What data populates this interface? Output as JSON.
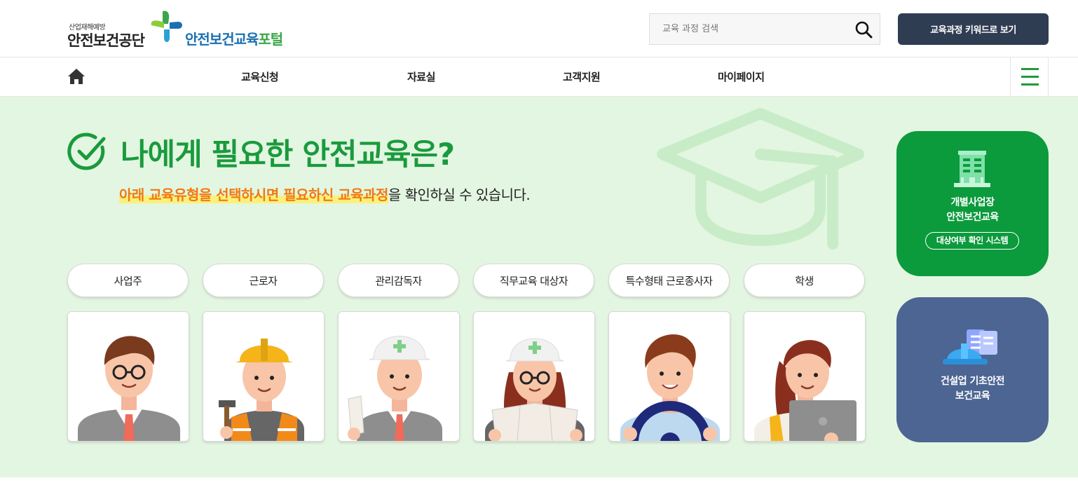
{
  "header": {
    "logo_small": "산업재해예방",
    "logo_main": "안전보건공단",
    "portal_part1": "안전보건교육",
    "portal_part2": "포털",
    "search_placeholder": "교육 과정 검색",
    "keyword_button": "교육과정 키워드로 보기"
  },
  "nav": {
    "items": [
      "교육신청",
      "자료실",
      "고객지원",
      "마이페이지"
    ]
  },
  "hero": {
    "title": "나에게 필요한 안전교육은?",
    "subtitle_highlight": "아래 교육유형을 선택하시면 필요하신 교육과정",
    "subtitle_rest": "을 확인하실 수 있습니다.",
    "categories": [
      "사업주",
      "근로자",
      "관리감독자",
      "직무교육 대상자",
      "특수형태 근로종사자",
      "학생"
    ]
  },
  "side": {
    "card1_line1": "개별사업장",
    "card1_line2": "안전보건교육",
    "card1_tag": "대상여부 확인 시스템",
    "card2_line1": "건설업 기초안전",
    "card2_line2": "보건교육"
  },
  "colors": {
    "brand_green": "#1a9a3d",
    "hero_bg": "#e3f6e1",
    "dark_button": "#2f3d52",
    "side_blue": "#4c6592",
    "highlight_orange": "#f07a12"
  }
}
